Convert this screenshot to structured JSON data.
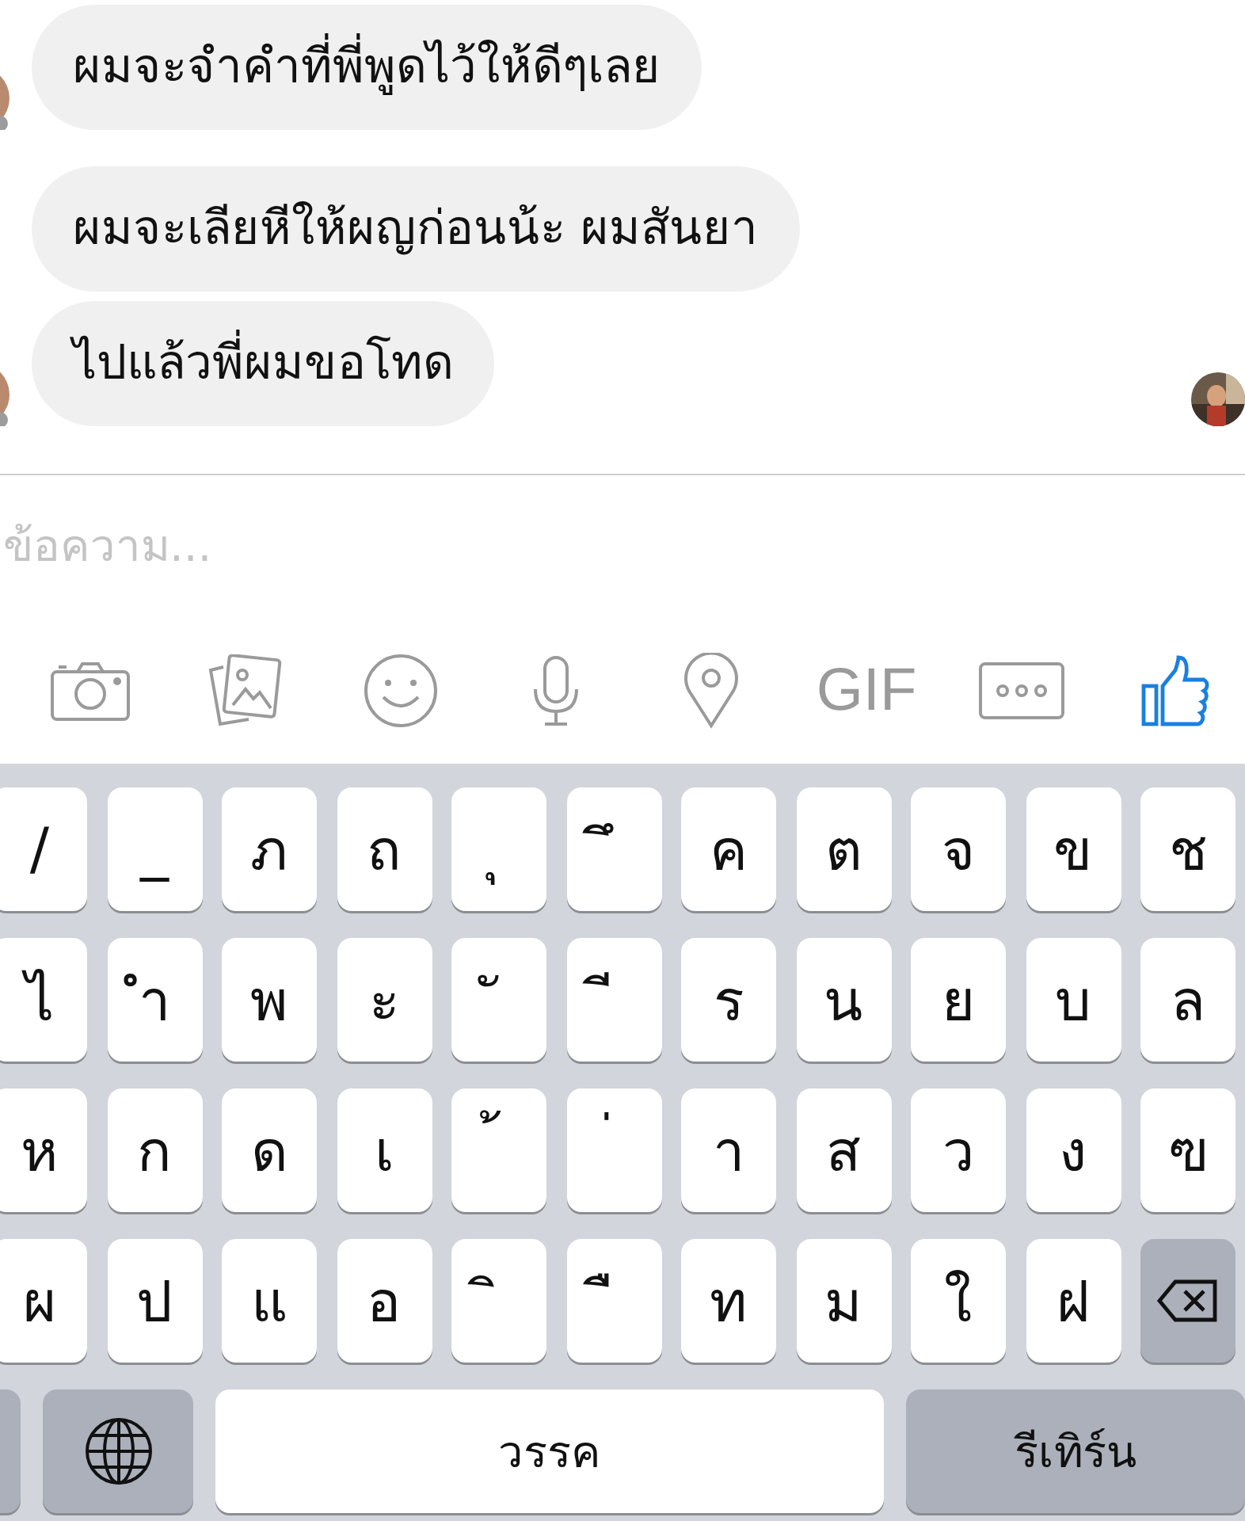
{
  "messages": [
    {
      "text": "ผมจะจำคำที่พี่พูดไว้ให้ดีๆเลย",
      "sender_avatar": true,
      "seen": false
    },
    {
      "text": "ผมจะเลียหีให้ผญก่อนน้ะ ผมสันยา",
      "sender_avatar": false,
      "seen": false
    },
    {
      "text": "ไปแล้วพี่ผมขอโทด",
      "sender_avatar": true,
      "seen": true
    }
  ],
  "composer": {
    "placeholder": "ข้อความ..."
  },
  "toolbar": [
    {
      "kind": "camera"
    },
    {
      "kind": "photos"
    },
    {
      "kind": "emoji"
    },
    {
      "kind": "mic"
    },
    {
      "kind": "location"
    },
    {
      "kind": "text",
      "label": "GIF"
    },
    {
      "kind": "more"
    },
    {
      "kind": "like"
    }
  ],
  "keyboard": {
    "rows": [
      [
        {
          "kind": "char",
          "label": "/"
        },
        {
          "kind": "char",
          "label": "_"
        },
        {
          "kind": "char",
          "label": "ภ"
        },
        {
          "kind": "char",
          "label": "ถ"
        },
        {
          "kind": "char",
          "label": "ุ"
        },
        {
          "kind": "char",
          "label": "ึ"
        },
        {
          "kind": "char",
          "label": "ค"
        },
        {
          "kind": "char",
          "label": "ต"
        },
        {
          "kind": "char",
          "label": "จ"
        },
        {
          "kind": "char",
          "label": "ข"
        },
        {
          "kind": "char",
          "label": "ช"
        }
      ],
      [
        {
          "kind": "char",
          "label": "ไ"
        },
        {
          "kind": "char",
          "label": "ำ"
        },
        {
          "kind": "char",
          "label": "พ"
        },
        {
          "kind": "char",
          "label": "ะ"
        },
        {
          "kind": "char",
          "label": "ั"
        },
        {
          "kind": "char",
          "label": "ี"
        },
        {
          "kind": "char",
          "label": "ร"
        },
        {
          "kind": "char",
          "label": "น"
        },
        {
          "kind": "char",
          "label": "ย"
        },
        {
          "kind": "char",
          "label": "บ"
        },
        {
          "kind": "char",
          "label": "ล"
        }
      ],
      [
        {
          "kind": "char",
          "label": "ห"
        },
        {
          "kind": "char",
          "label": "ก"
        },
        {
          "kind": "char",
          "label": "ด"
        },
        {
          "kind": "char",
          "label": "เ"
        },
        {
          "kind": "char",
          "label": "้"
        },
        {
          "kind": "char",
          "label": "่"
        },
        {
          "kind": "char",
          "label": "า"
        },
        {
          "kind": "char",
          "label": "ส"
        },
        {
          "kind": "char",
          "label": "ว"
        },
        {
          "kind": "char",
          "label": "ง"
        },
        {
          "kind": "char",
          "label": "ฃ"
        }
      ],
      [
        {
          "kind": "char",
          "label": "ผ"
        },
        {
          "kind": "char",
          "label": "ป"
        },
        {
          "kind": "char",
          "label": "แ"
        },
        {
          "kind": "char",
          "label": "อ"
        },
        {
          "kind": "char",
          "label": "ิ"
        },
        {
          "kind": "char",
          "label": "ื"
        },
        {
          "kind": "char",
          "label": "ท"
        },
        {
          "kind": "char",
          "label": "ม"
        },
        {
          "kind": "char",
          "label": "ใ"
        },
        {
          "kind": "char",
          "label": "ฝ"
        },
        {
          "kind": "backspace"
        }
      ]
    ],
    "bottom": [
      {
        "kind": "blank"
      },
      {
        "kind": "globe"
      },
      {
        "kind": "space",
        "label": "วรรค"
      },
      {
        "kind": "return",
        "label": "รีเทิร์น"
      }
    ]
  }
}
